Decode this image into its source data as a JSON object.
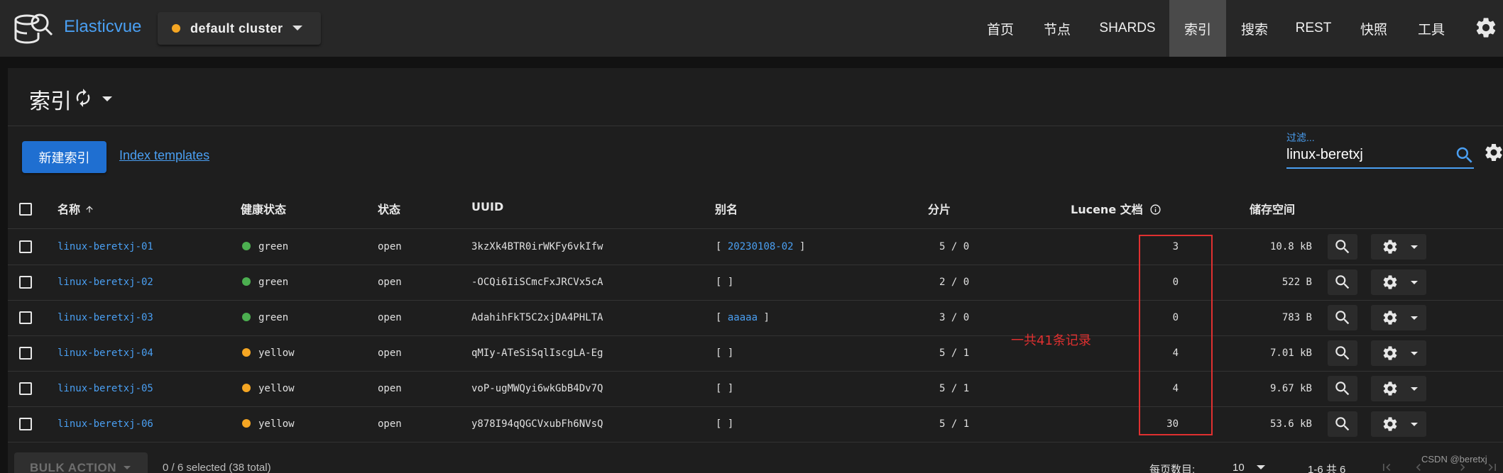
{
  "app": {
    "brand": "Elasticvue"
  },
  "cluster": {
    "name": "default cluster",
    "status_color": "#f5a623"
  },
  "nav": [
    {
      "label": "首页",
      "active": false
    },
    {
      "label": "节点",
      "active": false
    },
    {
      "label": "SHARDS",
      "active": false
    },
    {
      "label": "索引",
      "active": true
    },
    {
      "label": "搜索",
      "active": false
    },
    {
      "label": "REST",
      "active": false
    },
    {
      "label": "快照",
      "active": false
    },
    {
      "label": "工具",
      "active": false
    }
  ],
  "page": {
    "title": "索引"
  },
  "actions": {
    "new_index": "新建索引",
    "index_templates": "Index templates"
  },
  "filter": {
    "label": "过滤...",
    "value": "linux-beretxj"
  },
  "table": {
    "headers": {
      "name": "名称",
      "health": "健康状态",
      "status": "状态",
      "uuid": "UUID",
      "aliases": "别名",
      "shards": "分片",
      "docs": "Lucene 文档",
      "storage": "储存空间"
    },
    "rows": [
      {
        "name": "linux-beretxj-01",
        "health": "green",
        "health_color": "#4caf50",
        "status": "open",
        "uuid": "3kzXk4BTR0irWKFy6vkIfw",
        "alias_open": "[",
        "alias": "20230108-02",
        "alias_close": "]",
        "shards": "5 / 0",
        "docs": "3",
        "storage": "10.8 kB"
      },
      {
        "name": "linux-beretxj-02",
        "health": "green",
        "health_color": "#4caf50",
        "status": "open",
        "uuid": "-OCQi6IiSCmcFxJRCVx5cA",
        "alias_open": "[",
        "alias": "",
        "alias_close": "]",
        "shards": "2 / 0",
        "docs": "0",
        "storage": "522 B"
      },
      {
        "name": "linux-beretxj-03",
        "health": "green",
        "health_color": "#4caf50",
        "status": "open",
        "uuid": "AdahihFkT5C2xjDA4PHLTA",
        "alias_open": "[",
        "alias": "aaaaa",
        "alias_close": "]",
        "shards": "3 / 0",
        "docs": "0",
        "storage": "783 B"
      },
      {
        "name": "linux-beretxj-04",
        "health": "yellow",
        "health_color": "#f5a623",
        "status": "open",
        "uuid": "qMIy-ATeSiSqlIscgLA-Eg",
        "alias_open": "[",
        "alias": "",
        "alias_close": "]",
        "shards": "5 / 1",
        "docs": "4",
        "storage": "7.01 kB"
      },
      {
        "name": "linux-beretxj-05",
        "health": "yellow",
        "health_color": "#f5a623",
        "status": "open",
        "uuid": "voP-ugMWQyi6wkGbB4Dv7Q",
        "alias_open": "[",
        "alias": "",
        "alias_close": "]",
        "shards": "5 / 1",
        "docs": "4",
        "storage": "9.67 kB"
      },
      {
        "name": "linux-beretxj-06",
        "health": "yellow",
        "health_color": "#f5a623",
        "status": "open",
        "uuid": "y878I94qQGCVxubFh6NVsQ",
        "alias_open": "[",
        "alias": "",
        "alias_close": "]",
        "shards": "5 / 1",
        "docs": "30",
        "storage": "53.6 kB"
      }
    ]
  },
  "annotation": {
    "text": "一共41条记录",
    "color": "#e03030"
  },
  "footer": {
    "bulk_action": "BULK ACTION",
    "selected": "0 / 6 selected (38 total)",
    "per_page_label": "每页数目:",
    "per_page_value": "10",
    "page_range": "1-6 共 6"
  },
  "watermark": "CSDN @beretxj"
}
